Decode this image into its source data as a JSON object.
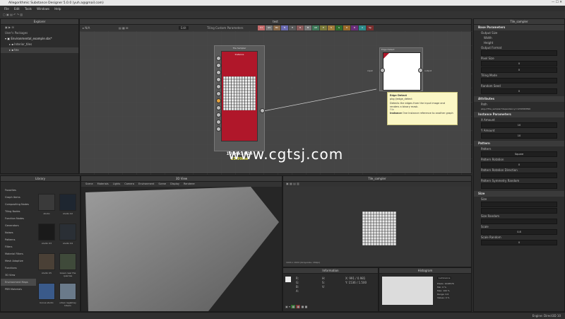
{
  "window": {
    "title": "Allegorithmic Substance Designer 5.0.0 (yuh.a@gmail.com)"
  },
  "menu": [
    "File",
    "Edit",
    "Tools",
    "Windows",
    "Help"
  ],
  "explorer": {
    "title": "Explorer",
    "header": "User's Packages",
    "items": [
      "Environmental_example.sbs*",
      "Interior_tiles",
      "tex"
    ]
  },
  "graph": {
    "title": "test",
    "toolbar": {
      "zoom": "N/A",
      "mode_label": "Edit",
      "param_label": "Tiling Custom Parameters"
    },
    "swatches": [
      {
        "label": "C1",
        "color": "#c56b6b"
      },
      {
        "label": "GS",
        "color": "#777777"
      },
      {
        "label": "BC",
        "color": "#8a6a4a"
      },
      {
        "label": "N",
        "color": "#6a6ab0"
      },
      {
        "label": "H",
        "color": "#5a5a5a"
      },
      {
        "label": "R",
        "color": "#8a5b5b"
      },
      {
        "label": "M",
        "color": "#7a7a7a"
      },
      {
        "label": "AO",
        "color": "#3f7a5a"
      },
      {
        "label": "E",
        "color": "#7a7a3a"
      },
      {
        "label": "S",
        "color": "#a07a3a"
      },
      {
        "label": "G",
        "color": "#2d6d2d"
      },
      {
        "label": "O",
        "color": "#9a6a2a"
      },
      {
        "label": "D",
        "color": "#6a2d7a"
      },
      {
        "label": "A",
        "color": "#2d8a8a"
      },
      {
        "label": "Sp",
        "color": "#7a2d2d"
      }
    ],
    "node_main": {
      "title": "Tile Sampler",
      "subtitle": "Instance",
      "resolution": "1024x1024",
      "time": "25.99ms"
    },
    "node_edge": {
      "title": "Edge Detect",
      "input_label": "input",
      "output_label": "output"
    },
    "tooltip": {
      "title": "Edge Detect",
      "path": "pkg://edge_detect",
      "desc": "Detects the edges from the input image and renders a binary mask.",
      "file_label": "File",
      "instance_label": "Instance",
      "instance_text": "One Instance reference to another graph"
    },
    "watermark": "www.cgtsj.com"
  },
  "library": {
    "title": "Library",
    "categories": [
      "Favorites",
      "Graph Items",
      "Compositing Nodes",
      "Tiling Nodes",
      "Function Nodes",
      "Generators",
      "Noises",
      "Patterns",
      "Filters",
      "Material Filters",
      "Mesh Adaptive",
      "Functions",
      "3D View",
      "Environment Maps",
      "PBR Materials"
    ],
    "selected_category": "Environment Maps",
    "thumbs": [
      "studio",
      "studio 02",
      "studio 03",
      "studio 04",
      "studio 05",
      "Green near the quarries",
      "bonus studio",
      "urban regalmey Interio"
    ]
  },
  "view3d": {
    "title": "3D View",
    "menu": [
      "Scene",
      "Materials",
      "Lights",
      "Camera",
      "Environment",
      "Scene",
      "Display",
      "Renderer"
    ]
  },
  "view2d": {
    "title": "Tile_sampler",
    "status": "1024 x 1024 (Grayscale, 16bpc)",
    "zoom": "100%"
  },
  "information": {
    "title": "Information",
    "labels": [
      "R:",
      "G:",
      "B:",
      "A:"
    ],
    "hsv": [
      "H:",
      "S:",
      "V:"
    ],
    "coords": [
      "X: 991 / 0.981",
      "Y: 1536 / 1.500"
    ]
  },
  "histogram": {
    "title": "Histogram",
    "channel": "Luminance",
    "stats": [
      "Pixels: 1048576",
      "Min: 0 %",
      "Max: 100 %",
      "Range: 0.6",
      "Values: 0 %"
    ]
  },
  "properties": {
    "title": "Tile_sampler",
    "sections": {
      "base": "Base Parameters",
      "output_size": "Output Size",
      "output_format": "Output Format",
      "pixel_size": "Pixel Size",
      "tiling_mode": "Tiling Mode",
      "random_seed": "Random Seed",
      "attributes": "Attributes",
      "path_label": "Path",
      "path_value": "pkg:///Tile_sampler?dependency=1234567890",
      "instance": "Instance Parameters",
      "x_amount": "X Amount",
      "y_amount": "Y Amount",
      "pattern": "Pattern",
      "pattern_sub": "Pattern",
      "pattern_value": "Square",
      "pattern_rotation": "Pattern Rotation",
      "pattern_rotation_value": "0",
      "pattern_rot_dir": "Pattern Rotation Direction",
      "pattern_sym": "Pattern Symmetry Random",
      "size": "Size",
      "size_label": "Size",
      "size_random": "Size Random",
      "scale": "Scale",
      "scale_random": "Scale Random"
    },
    "values": {
      "width": "Width",
      "height": "Height",
      "width_v": "Input: 0",
      "height_v": "Input: 0",
      "px_width": "0",
      "px_height": "0",
      "seed": "0",
      "x_amount": "10",
      "y_amount": "10",
      "scale": "0.8",
      "scale_random": "0"
    }
  },
  "status_bar": {
    "engine": "Engine: Direct3D 10"
  }
}
